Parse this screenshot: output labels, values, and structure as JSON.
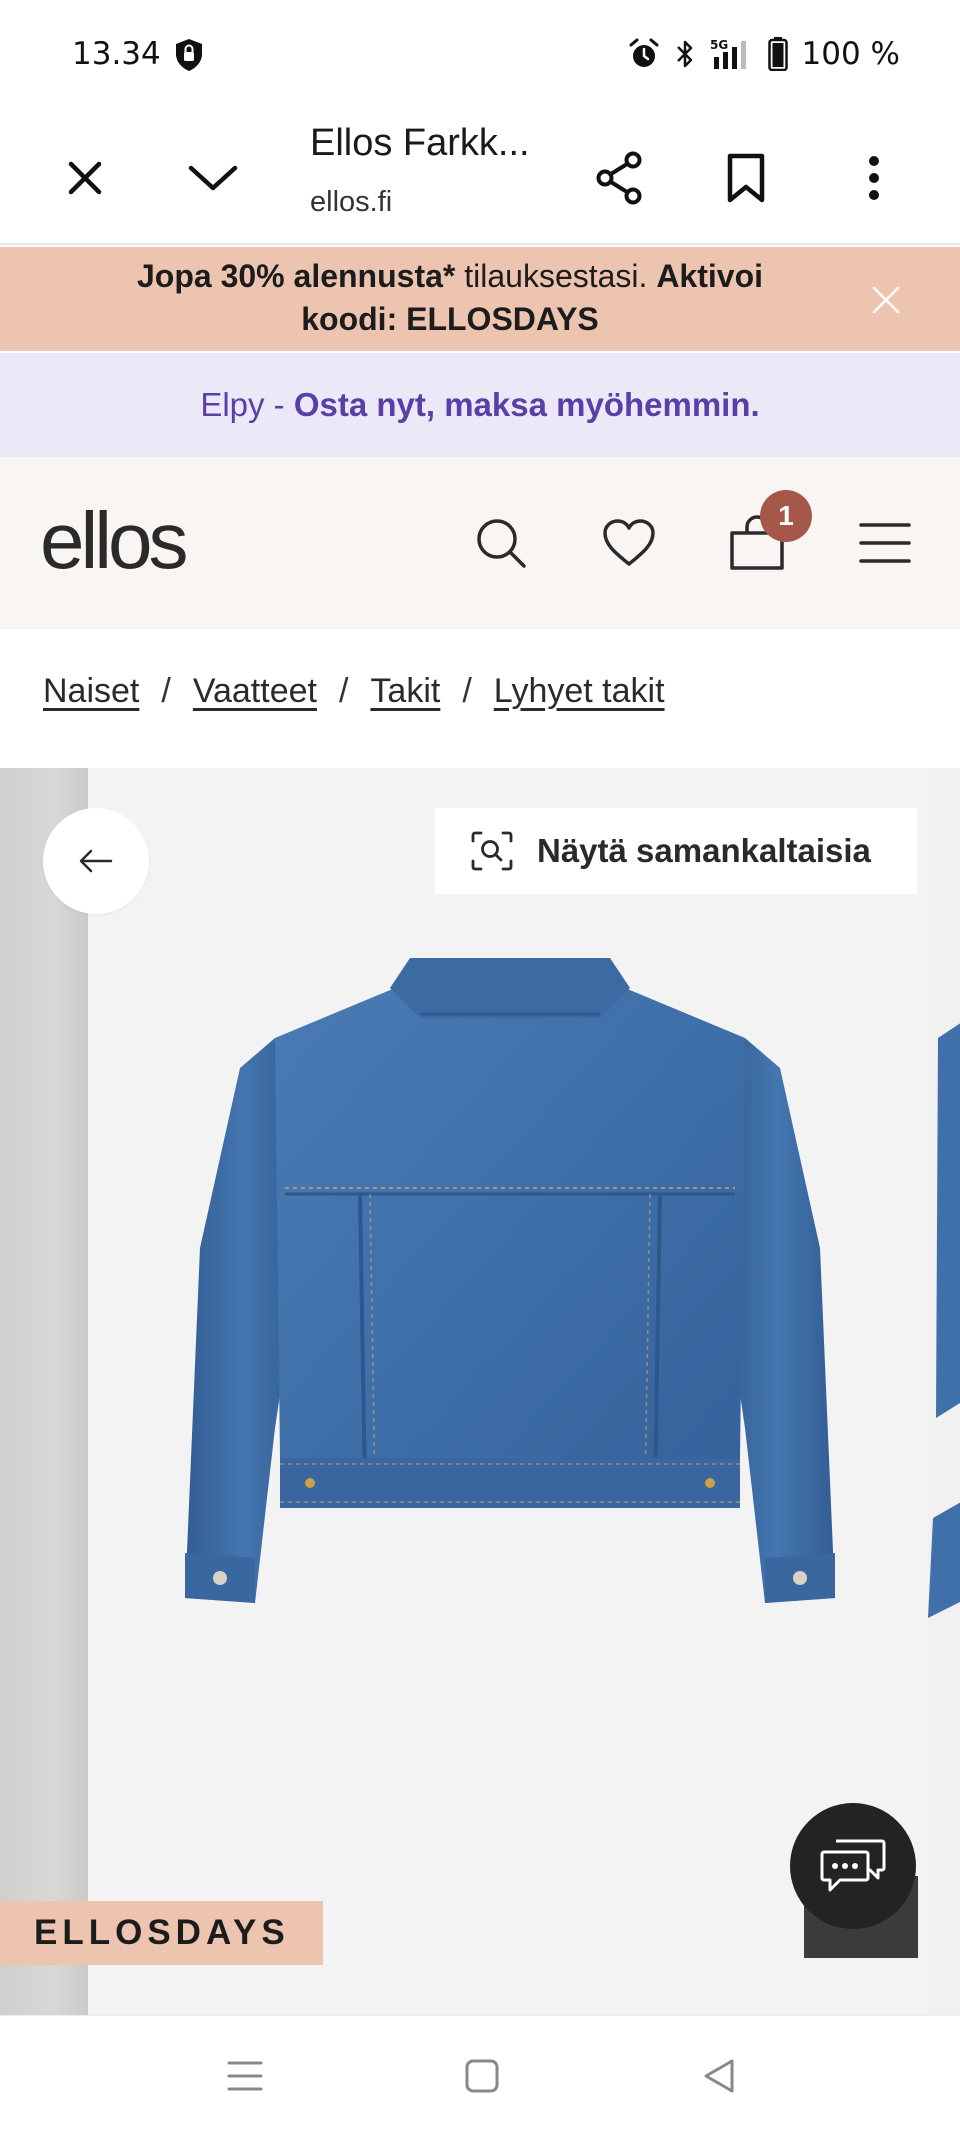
{
  "status_bar": {
    "time": "13.34",
    "network": "5G",
    "battery": "100 %"
  },
  "browser": {
    "title": "Ellos Farkk...",
    "url": "ellos.fi"
  },
  "promo": {
    "bold_1": "Jopa 30% alennusta*",
    "normal_1": " tilauksestasi. ",
    "bold_2": "Aktivoi koodi: ELLOSDAYS"
  },
  "elpy": {
    "prefix": "Elpy - ",
    "bold": "Osta nyt, maksa myöhemmin."
  },
  "header": {
    "logo": "ellos",
    "cart_count": "1"
  },
  "breadcrumb": {
    "items": [
      "Naiset",
      "Vaatteet",
      "Takit",
      "Lyhyet takit"
    ],
    "separator": "/"
  },
  "gallery": {
    "similar_label": "Näytä samankaltaisia",
    "tag": "ELLOSDAYS"
  },
  "colors": {
    "promo_bg": "#ecc4b0",
    "elpy_bg": "#ebe8f7",
    "elpy_text": "#5a3fa8",
    "header_bg": "#f8f5f2",
    "cart_badge": "#a5574a",
    "denim": "#3d6ea8"
  }
}
